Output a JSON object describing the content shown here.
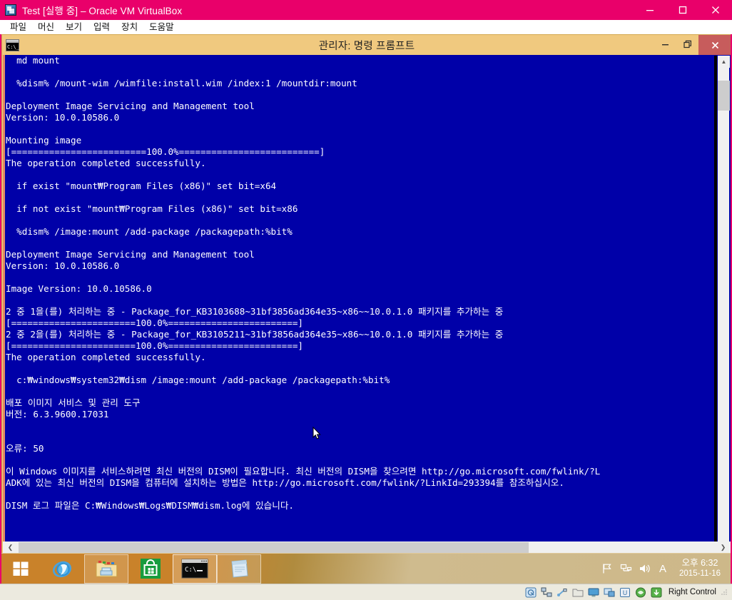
{
  "vbox": {
    "title": "Test [실행 중] – Oracle VM VirtualBox",
    "app_icon": "virtualbox-icon",
    "window_controls": [
      {
        "name": "minimize",
        "glyph": "—"
      },
      {
        "name": "maximize",
        "glyph": "□"
      },
      {
        "name": "close",
        "glyph": "✕"
      }
    ],
    "menu": [
      {
        "label": "파일"
      },
      {
        "label": "머신"
      },
      {
        "label": "보기"
      },
      {
        "label": "입력"
      },
      {
        "label": "장치"
      },
      {
        "label": "도움말"
      }
    ],
    "statusbar": {
      "host_key": "Right Control",
      "icons": [
        "harddisk-icon",
        "network-icon",
        "usb-icon",
        "shared-folder-icon",
        "display-icon",
        "remote-desktop-icon",
        "video-capture-icon",
        "mouse-integration-icon",
        "host-key-icon"
      ]
    },
    "colors": {
      "title_bg": "#e9006a",
      "menu_bg": "#ffffff",
      "status_bg": "#eceadf"
    }
  },
  "cmd_window": {
    "title": "관리자: 명령 프롬프트",
    "icon": "command-prompt-icon",
    "window_controls": [
      {
        "name": "minimize",
        "glyph": "—"
      },
      {
        "name": "restore",
        "glyph": "❐"
      },
      {
        "name": "close",
        "glyph": "✕"
      }
    ],
    "colors": {
      "title_bg": "#f0c97f",
      "close_bg": "#c75c5c",
      "console_bg": "#0000a8",
      "console_fg": "#ffffff",
      "cursor": "#c8c84a"
    },
    "console_lines": [
      "  md mount",
      "",
      "  %dism% /mount-wim /wimfile:install.wim /index:1 /mountdir:mount",
      "",
      "Deployment Image Servicing and Management tool",
      "Version: 10.0.10586.0",
      "",
      "Mounting image",
      "[=========================100.0%==========================]",
      "The operation completed successfully.",
      "",
      "  if exist \"mount₩Program Files (x86)\" set bit=x64",
      "",
      "  if not exist \"mount₩Program Files (x86)\" set bit=x86",
      "",
      "  %dism% /image:mount /add-package /packagepath:%bit%",
      "",
      "Deployment Image Servicing and Management tool",
      "Version: 10.0.10586.0",
      "",
      "Image Version: 10.0.10586.0",
      "",
      "2 중 1을(를) 처리하는 중 - Package_for_KB3103688~31bf3856ad364e35~x86~~10.0.1.0 패키지를 추가하는 중",
      "[=======================100.0%========================]",
      "2 중 2을(를) 처리하는 중 - Package_for_KB3105211~31bf3856ad364e35~x86~~10.0.1.0 패키지를 추가하는 중",
      "[=======================100.0%========================]",
      "The operation completed successfully.",
      "",
      "  c:₩windows₩system32₩dism /image:mount /add-package /packagepath:%bit%",
      "",
      "배포 이미지 서비스 및 관리 도구",
      "버전: 6.3.9600.17031",
      "",
      "",
      "오류: 50",
      "",
      "이 Windows 이미지를 서비스하려면 최신 버전의 DISM이 필요합니다. 최신 버전의 DISM을 찾으려면 http://go.microsoft.com/fwlink/?L",
      "ADK에 있는 최신 버전의 DISM을 컴퓨터에 설치하는 방법은 http://go.microsoft.com/fwlink/?LinkId=293394를 참조하십시오.",
      "",
      "DISM 로그 파일은 C:₩Windows₩Logs₩DISM₩dism.log에 있습니다.",
      ""
    ],
    "vscrollbar": {
      "up_glyph": "▲",
      "down_glyph": "▼"
    },
    "hscrollbar": {
      "left_glyph": "❮",
      "right_glyph": "❯"
    }
  },
  "taskbar": {
    "start_button": "start-button",
    "apps": [
      {
        "name": "internet-explorer",
        "state": "normal"
      },
      {
        "name": "file-explorer",
        "state": "open"
      },
      {
        "name": "store",
        "state": "normal"
      },
      {
        "name": "command-prompt",
        "state": "active"
      },
      {
        "name": "notepad",
        "state": "open"
      }
    ],
    "tray_icons": [
      "action-center-flag-icon",
      "network-icon",
      "volume-icon",
      "ime-indicator"
    ],
    "ime_label": "A",
    "clock": {
      "time": "오후 6:32",
      "date": "2015-11-16"
    }
  }
}
